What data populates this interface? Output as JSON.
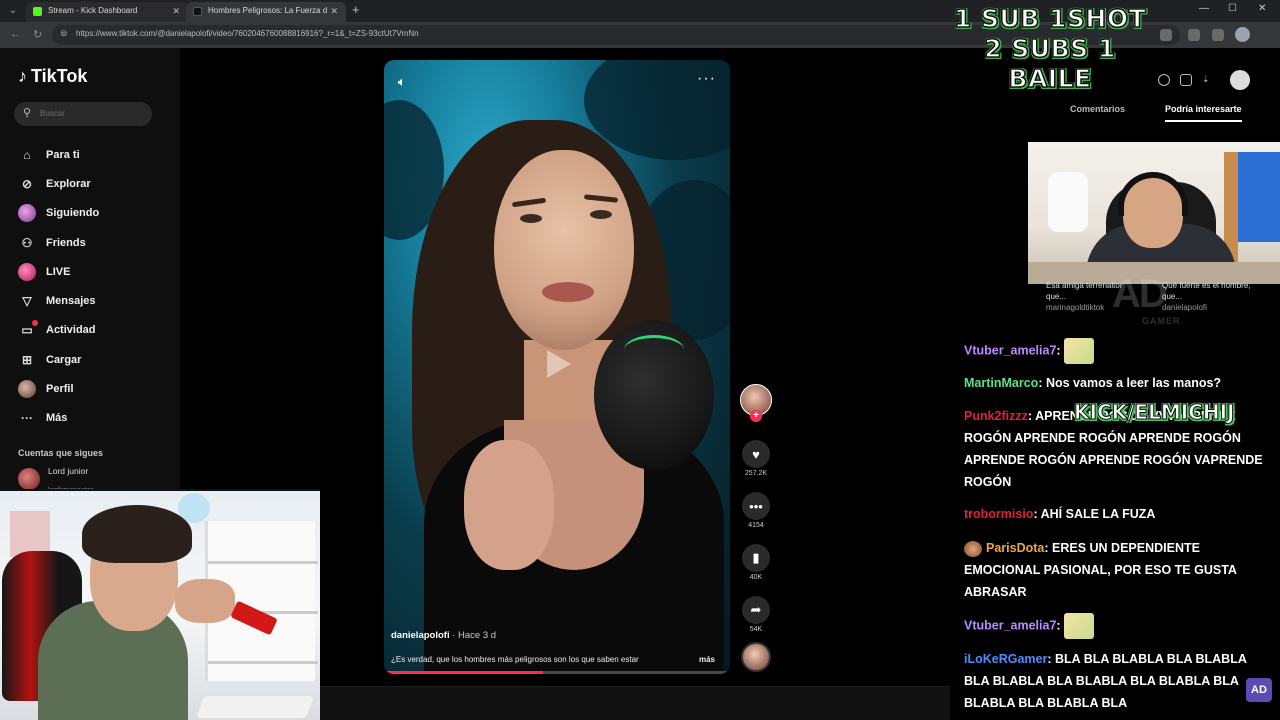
{
  "browser": {
    "tabs": [
      {
        "title": "Stream - Kick Dashboard",
        "favicon_color": "#53fc18"
      },
      {
        "title": "Hombres Peligrosos: La Fuerza d",
        "favicon_color": "#111111"
      }
    ],
    "new_tab": "+",
    "url": "https://www.tiktok.com/@danielapolofi/video/7602046760088816916?_r=1&_t=ZS-93ctUt7VmNn",
    "window_controls": {
      "minimize": "—",
      "maximize": "☐",
      "close": "✕"
    }
  },
  "tiktok": {
    "logo": "TikTok",
    "search_placeholder": "Buscar",
    "nav": [
      {
        "label": "Para ti",
        "icon": "home-icon"
      },
      {
        "label": "Explorar",
        "icon": "compass-icon"
      },
      {
        "label": "Siguiendo",
        "icon": "following-avatar-icon"
      },
      {
        "label": "Friends",
        "icon": "friends-icon"
      },
      {
        "label": "LIVE",
        "icon": "live-icon"
      },
      {
        "label": "Mensajes",
        "icon": "messages-icon"
      },
      {
        "label": "Actividad",
        "icon": "activity-icon"
      },
      {
        "label": "Cargar",
        "icon": "upload-icon"
      },
      {
        "label": "Perfil",
        "icon": "profile-avatar-icon"
      },
      {
        "label": "Más",
        "icon": "more-icon"
      }
    ],
    "following_header": "Cuentas que sigues",
    "following": [
      {
        "name": "Lord junior",
        "handle": "lordjrmoneator"
      }
    ],
    "video": {
      "author": "danielapolofi",
      "ago": "· Hace 3 d",
      "caption": "¿Es verdad, que los hombres más peligrosos son los que saben estar",
      "more": "más",
      "progress": 0.46
    },
    "actions": [
      {
        "name": "like",
        "icon": "heart-icon",
        "count": "257.2K"
      },
      {
        "name": "comment",
        "icon": "comment-icon",
        "count": "4154"
      },
      {
        "name": "save",
        "icon": "bookmark-icon",
        "count": "40K"
      },
      {
        "name": "share",
        "icon": "share-icon",
        "count": "54K"
      }
    ],
    "right_tabs": [
      "Comentarios",
      "Podría interesarte"
    ],
    "suggestions": [
      {
        "title": "Esa amiga terrenaltor que...",
        "author": "marinagoldtiktok"
      },
      {
        "title": "Qué fuerte es el hombre, que...",
        "author": "danielapolofi"
      }
    ]
  },
  "overlay": {
    "sub_line_1": "1 SUB  1SHOT",
    "sub_line_2": "2 SUBS 1 BAILE",
    "kick_tag": "KICK/ELMICHIJ",
    "ad_logo": "AD",
    "watermark": "AD",
    "watermark_sub": "GAMER"
  },
  "chat": [
    {
      "user": "Vtuber_amelia7",
      "color": "#b78cff",
      "text": "",
      "emote": true
    },
    {
      "user": "MartinMarco",
      "color": "#5ee08a",
      "text": "Nos vamos a leer las manos?"
    },
    {
      "user": "Punk2fizzz",
      "color": "#e0213b",
      "text": "APRENDE ROGÓN VVVAPRENDE ROGÓN APRENDE ROGÓN APRENDE ROGÓN APRENDE ROGÓN APRENDE ROGÓN VAPRENDE ROGÓN"
    },
    {
      "user": "trobormisio",
      "color": "#e0213b",
      "text": "AHÍ SALE LA FUZA"
    },
    {
      "user": "ParisDota",
      "color": "#f0a645",
      "text": "ERES UN DEPENDIENTE EMOCIONAL PASIONAL, POR ESO TE GUSTA ABRASAR",
      "badge": true
    },
    {
      "user": "Vtuber_amelia7",
      "color": "#b78cff",
      "text": "",
      "emote": true
    },
    {
      "user": "iLoKeRGamer",
      "color": "#4d8dff",
      "text": "BLA BLA BLABLA BLA BLABLA BLA BLABLA BLA BLABLA BLA BLABLA BLA BLABLA BLA BLABLA BLA"
    }
  ],
  "colors": {
    "tiktok_red": "#fe2c55",
    "kick_green": "#53fc18"
  }
}
